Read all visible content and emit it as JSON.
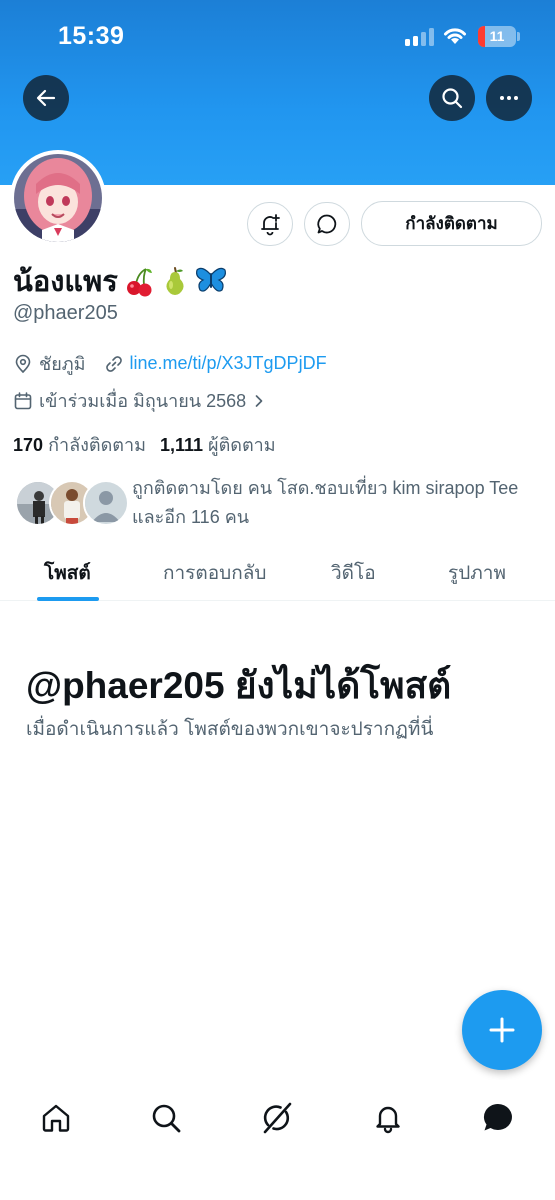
{
  "status_bar": {
    "time": "15:39",
    "battery_level": "11",
    "battery_fraction": 0.11
  },
  "header": {
    "back_icon": "arrow-left-icon",
    "search_icon": "search-icon",
    "more_icon": "more-horizontal-icon",
    "banner_color": "#1d9bf0"
  },
  "profile": {
    "display_name": "น้องแพร",
    "emojis": [
      "cherries",
      "pear",
      "butterfly"
    ],
    "handle": "@phaer205",
    "location": "ชัยภูมิ",
    "link": "line.me/ti/p/X3JTgDPjDF",
    "joined": "เข้าร่วมเมื่อ มิถุนายน 2568",
    "following_count": "170",
    "following_label": "กำลังติดตาม",
    "followers_count": "1,111",
    "followers_label": "ผู้ติดตาม",
    "followed_by_text": "ถูกติดตามโดย คน โสด.ชอบเที่ยว kim sirapop Tee และอีก 116 คน"
  },
  "actions": {
    "notify_icon": "bell-plus-icon",
    "message_icon": "message-bubble-icon",
    "following_button_label": "กำลังติดตาม"
  },
  "tabs": [
    {
      "label": "โพสต์",
      "active": true
    },
    {
      "label": "การตอบกลับ",
      "active": false
    },
    {
      "label": "วิดีโอ",
      "active": false
    },
    {
      "label": "รูปภาพ",
      "active": false
    }
  ],
  "empty_state": {
    "title": "@phaer205 ยังไม่ได้โพสต์",
    "subtitle": "เมื่อดำเนินการแล้ว โพสต์ของพวกเขาจะปรากฏที่นี่"
  },
  "fab": {
    "icon": "plus-icon",
    "color": "#1d9bf0"
  },
  "bottom_nav": [
    {
      "icon": "home-icon"
    },
    {
      "icon": "search-icon"
    },
    {
      "icon": "grok-icon"
    },
    {
      "icon": "bell-icon"
    },
    {
      "icon": "messages-icon"
    }
  ]
}
